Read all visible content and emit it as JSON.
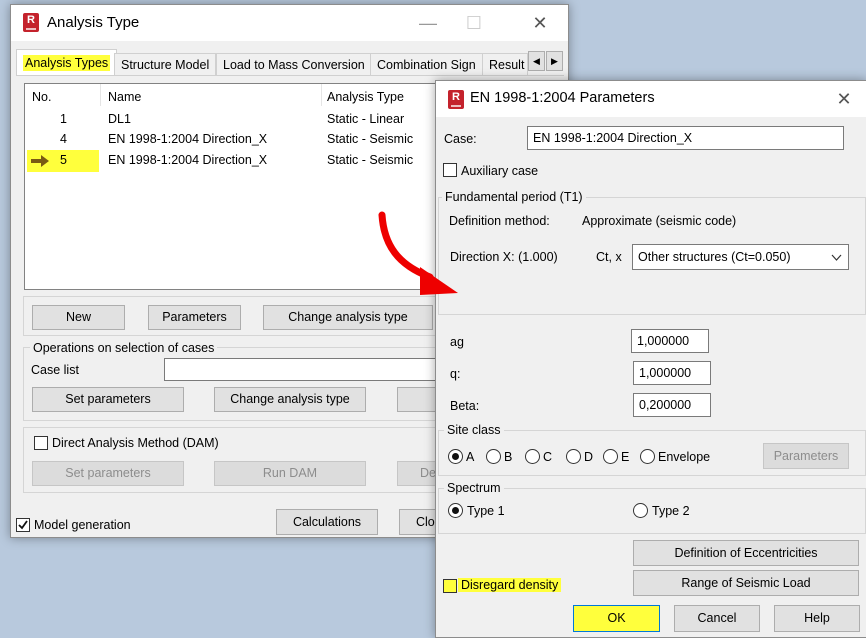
{
  "analysis_window": {
    "title": "Analysis Type",
    "tabs": [
      "Analysis Types",
      "Structure Model",
      "Load to Mass Conversion",
      "Combination Sign",
      "Result"
    ],
    "table": {
      "columns": [
        "No.",
        "Name",
        "Analysis Type"
      ],
      "rows": [
        {
          "no": "1",
          "name": "DL1",
          "type": "Static - Linear"
        },
        {
          "no": "4",
          "name": "EN 1998-1:2004 Direction_X",
          "type": "Static - Seismic"
        },
        {
          "no": "5",
          "name": "EN 1998-1:2004 Direction_X",
          "type": "Static - Seismic"
        }
      ]
    },
    "new_btn": "New",
    "parameters_btn": "Parameters",
    "change_analysis_btn": "Change analysis type",
    "ops_group": "Operations on selection of cases",
    "case_list_label": "Case list",
    "set_parameters_btn": "Set parameters",
    "change_analysis_btn2": "Change analysis type",
    "dam_label": "Direct Analysis Method (DAM)",
    "dam_set_parameters_btn": "Set parameters",
    "run_dam_btn": "Run DAM",
    "dam_partial_btn": "De",
    "model_generation_label": "Model generation",
    "calculations_btn": "Calculations",
    "close_partial_btn": "Clos"
  },
  "params_dialog": {
    "title": "EN 1998-1:2004 Parameters",
    "case_label": "Case:",
    "case_value": "EN 1998-1:2004 Direction_X",
    "auxiliary_label": "Auxiliary case",
    "fundamental_group": "Fundamental period (T1)",
    "definition_label": "Definition method:",
    "definition_value": "Approximate (seismic code)",
    "direction_label": "Direction X: (1.000)",
    "ct_label": "Ct, x",
    "ct_value": "Other structures (Ct=0.050)",
    "ag_label": "ag",
    "ag_value": "1,000000",
    "q_label": "q:",
    "q_value": "1,000000",
    "beta_label": "Beta:",
    "beta_value": "0,200000",
    "site_class_group": "Site class",
    "site_classes": [
      "A",
      "B",
      "C",
      "D",
      "E",
      "Envelope"
    ],
    "site_parameters_btn": "Parameters",
    "spectrum_group": "Spectrum",
    "type1_label": "Type 1",
    "type2_label": "Type 2",
    "eccentricities_btn": "Definition of Eccentricities",
    "range_btn": "Range of Seismic Load",
    "disregard_label": "Disregard density",
    "ok_btn": "OK",
    "cancel_btn": "Cancel",
    "help_btn": "Help"
  }
}
